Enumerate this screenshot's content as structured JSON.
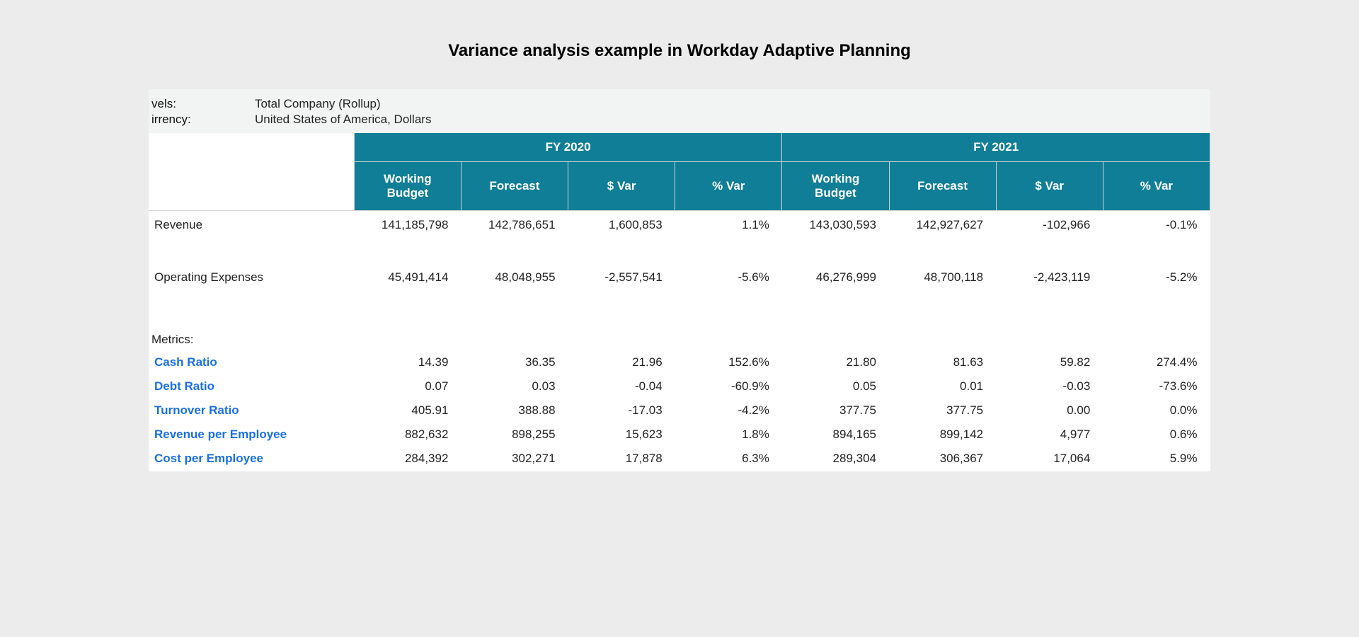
{
  "title": "Variance analysis example in Workday Adaptive Planning",
  "meta": {
    "levels_label": "vels:",
    "levels_value": "Total Company (Rollup)",
    "currency_label": "irrency:",
    "currency_value": "United States of America, Dollars"
  },
  "headers": {
    "years": [
      "FY 2020",
      "FY 2021"
    ],
    "sub": [
      "Working Budget",
      "Forecast",
      "$ Var",
      "% Var"
    ]
  },
  "rows": {
    "revenue": {
      "label": "Revenue",
      "values": [
        "141,185,798",
        "142,786,651",
        "1,600,853",
        "1.1%",
        "143,030,593",
        "142,927,627",
        "-102,966",
        "-0.1%"
      ]
    },
    "opex": {
      "label": "Operating Expenses",
      "values": [
        "45,491,414",
        "48,048,955",
        "-2,557,541",
        "-5.6%",
        "46,276,999",
        "48,700,118",
        "-2,423,119",
        "-5.2%"
      ]
    }
  },
  "section_label": "Metrics:",
  "metrics": {
    "cash": {
      "label": "Cash Ratio",
      "values": [
        "14.39",
        "36.35",
        "21.96",
        "152.6%",
        "21.80",
        "81.63",
        "59.82",
        "274.4%"
      ]
    },
    "debt": {
      "label": "Debt Ratio",
      "values": [
        "0.07",
        "0.03",
        "-0.04",
        "-60.9%",
        "0.05",
        "0.01",
        "-0.03",
        "-73.6%"
      ]
    },
    "turn": {
      "label": "Turnover Ratio",
      "values": [
        "405.91",
        "388.88",
        "-17.03",
        "-4.2%",
        "377.75",
        "377.75",
        "0.00",
        "0.0%"
      ]
    },
    "rpe": {
      "label": "Revenue per Employee",
      "values": [
        "882,632",
        "898,255",
        "15,623",
        "1.8%",
        "894,165",
        "899,142",
        "4,977",
        "0.6%"
      ]
    },
    "cpe": {
      "label": "Cost per Employee",
      "values": [
        "284,392",
        "302,271",
        "17,878",
        "6.3%",
        "289,304",
        "306,367",
        "17,064",
        "5.9%"
      ]
    }
  }
}
